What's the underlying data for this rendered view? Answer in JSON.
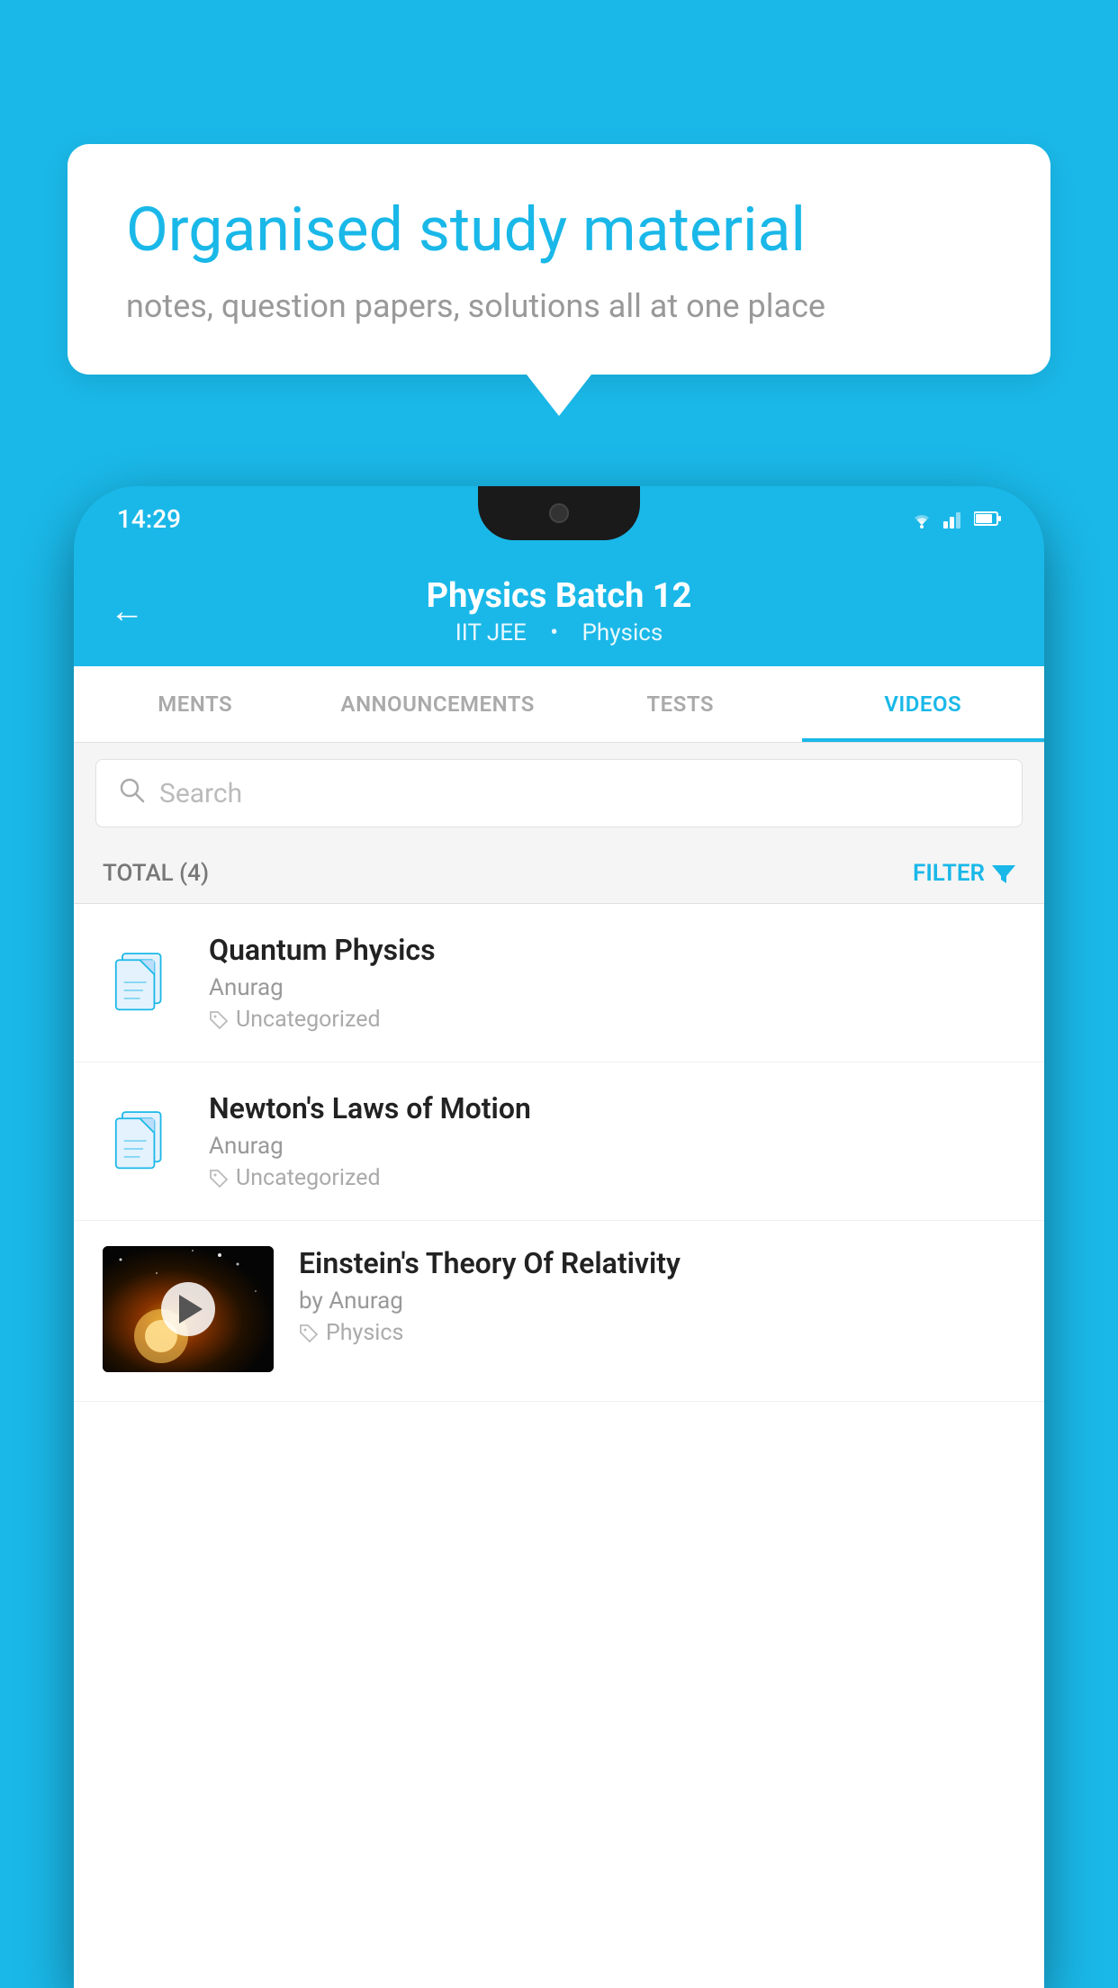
{
  "background_color": "#1ab8e8",
  "bubble": {
    "title": "Organised study material",
    "subtitle": "notes, question papers, solutions all at one place"
  },
  "phone": {
    "status_bar": {
      "time": "14:29",
      "wifi": "▾",
      "signal": "▾",
      "battery": "▮"
    },
    "header": {
      "back_label": "←",
      "title": "Physics Batch 12",
      "subtitle_tag1": "IIT JEE",
      "subtitle_tag2": "Physics"
    },
    "tabs": [
      {
        "label": "MENTS",
        "active": false
      },
      {
        "label": "ANNOUNCEMENTS",
        "active": false
      },
      {
        "label": "TESTS",
        "active": false
      },
      {
        "label": "VIDEOS",
        "active": true
      }
    ],
    "search": {
      "placeholder": "Search"
    },
    "filter_bar": {
      "total_label": "TOTAL (4)",
      "filter_label": "FILTER"
    },
    "videos": [
      {
        "id": 1,
        "title": "Quantum Physics",
        "author": "Anurag",
        "tag": "Uncategorized",
        "has_thumb": false
      },
      {
        "id": 2,
        "title": "Newton's Laws of Motion",
        "author": "Anurag",
        "tag": "Uncategorized",
        "has_thumb": false
      },
      {
        "id": 3,
        "title": "Einstein's Theory Of Relativity",
        "author": "by Anurag",
        "tag": "Physics",
        "has_thumb": true
      }
    ]
  }
}
